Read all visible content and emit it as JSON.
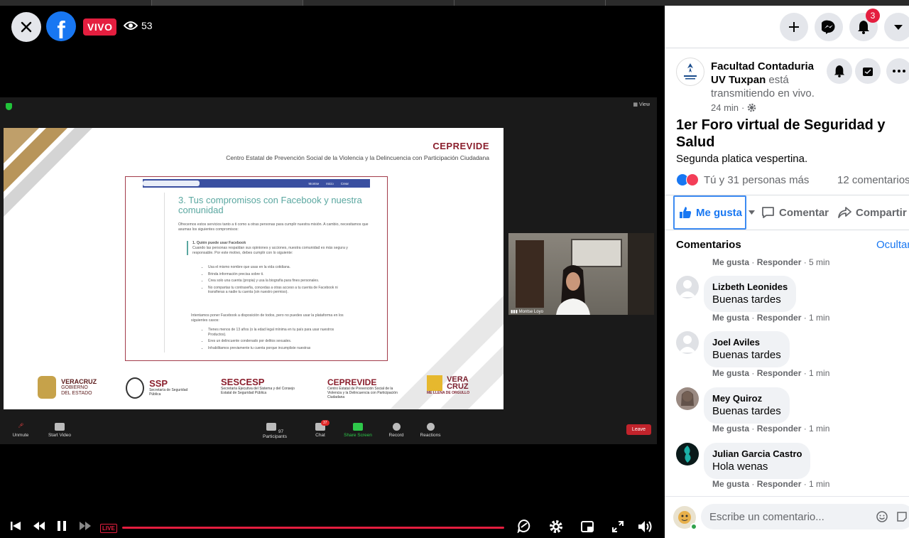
{
  "player": {
    "live_badge": "VIVO",
    "viewer_count": "53",
    "live_pill": "LIVE",
    "progress": 1.0
  },
  "zoom": {
    "view_label": "View",
    "slide": {
      "org_title": "CEPREVIDE",
      "org_subtitle": "Centro Estatal de Prevención Social de la Violencia y la Delincuencia con Participación Ciudadana",
      "section_title": "3. Tus compromisos con Facebook y nuestra comunidad",
      "intro_text": "Ofrecemos estos servicios tanto a ti como a otras personas para cumplir nuestra misión. A cambio, necesitamos que asumas los siguientes compromisos:",
      "subhead": "1. Quién puede usar Facebook",
      "subhead_text": "Cuando las personas respaldan sus opiniones y acciones, nuestra comunidad es más segura y responsable. Por este motivo, debes cumplir con lo siguiente:",
      "bullets1": [
        "Usa el mismo nombre que usas en la vida cotidiana.",
        "Brinda información precisa sobre ti.",
        "Crea solo una cuenta (propia) y usa la biografía para fines personales.",
        "No compartas tu contraseña, concedas a otras acceso a tu cuenta de Facebook ni transfieras a nadie tu cuenta (sin nuestro permiso)."
      ],
      "middle_text": "Intentamos poner Facebook a disposición de todos, pero no puedes usar la plataforma en los siguientes casos:",
      "bullets2": [
        "Tienes menos de 13 años (o la edad legal mínima en tu país para usar nuestros Productos).",
        "Eres un delincuente condenado por delitos sexuales.",
        "Inhabilitamos previamente tu cuenta porque incumpliste nuestras"
      ],
      "fb_bar_items": [
        "Montse",
        "Inicio",
        "Crear"
      ],
      "logos": [
        {
          "name": "VERACRUZ",
          "sub": "GOBIERNO DEL ESTADO"
        },
        {
          "name": "SSP",
          "sub": "Secretaría de Seguridad Pública"
        },
        {
          "name": "SESCESP",
          "sub": "Secretaría Ejecutiva del Sistema y del Consejo Estatal de Seguridad Pública"
        },
        {
          "name": "CEPREVIDE",
          "sub": "Centro Estatal de Prevención Social de la Violencia y la Delincuencia con Participación Ciudadana"
        },
        {
          "name": "VERA CRUZ",
          "sub": "ME LLENA DE ORGULLO"
        }
      ]
    },
    "participant_name": "Montse Loyo",
    "toolbar": {
      "unmute": "Unmute",
      "start_video": "Start Video",
      "participants": "Participants",
      "participants_count": "97",
      "chat": "Chat",
      "chat_badge": "37",
      "share_screen": "Share Screen",
      "record": "Record",
      "reactions": "Reactions",
      "leave": "Leave"
    }
  },
  "header": {
    "notification_count": "3"
  },
  "post": {
    "page_name": "Facultad Contaduria UV Tuxpan",
    "status_text": "está transmitiendo en vivo.",
    "time": "24 min",
    "title": "1er Foro virtual de Seguridad y Salud",
    "subtitle": "Segunda platica vespertina.",
    "reactions_text": "Tú y 31 personas más",
    "comments_count": "12 comentarios",
    "like_label": "Me gusta",
    "comment_label": "Comentar",
    "share_label": "Compartir"
  },
  "comments_section": {
    "heading": "Comentarios",
    "hide_label": "Ocultar",
    "partial_meta": {
      "like": "Me gusta",
      "reply": "Responder",
      "time": "5 min"
    },
    "items": [
      {
        "name": "Lizbeth Leonides",
        "text": "Buenas tardes",
        "like": "Me gusta",
        "reply": "Responder",
        "time": "1 min"
      },
      {
        "name": "Joel Aviles",
        "text": "Buenas tardes",
        "like": "Me gusta",
        "reply": "Responder",
        "time": "1 min"
      },
      {
        "name": "Mey Quiroz",
        "text": "Buenas tardes",
        "like": "Me gusta",
        "reply": "Responder",
        "time": "1 min"
      },
      {
        "name": "Julian Garcia Castro",
        "text": "Hola wenas",
        "like": "Me gusta",
        "reply": "Responder",
        "time": "1 min"
      }
    ],
    "composer_placeholder": "Escribe un comentario..."
  }
}
